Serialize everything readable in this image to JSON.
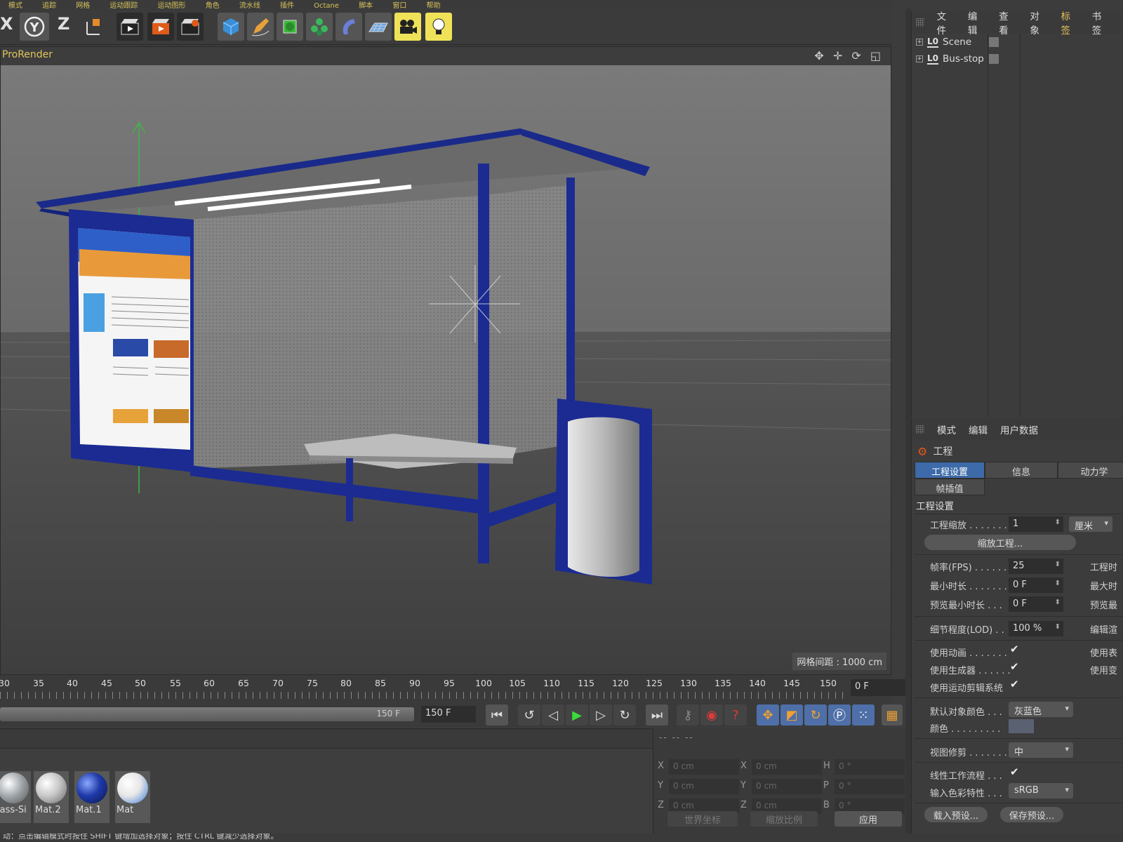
{
  "app": {
    "top_menu": [
      "模式",
      "追踪",
      "网格",
      "运动跟踪",
      "运动图形",
      "角色",
      "流水线",
      "插件",
      "Octane",
      "脚本",
      "窗口",
      "帮助"
    ]
  },
  "toolbar": {
    "x_label": "X",
    "y_label": "Y",
    "z_label": "Z"
  },
  "viewport": {
    "renderer_label": "ProRender",
    "nav_icons": "✥ ✛ ⟳ ◱",
    "grid_spacing": "网格间距 : 1000 cm"
  },
  "timeline": {
    "ticks": [
      "30",
      "35",
      "40",
      "45",
      "50",
      "55",
      "60",
      "65",
      "70",
      "75",
      "80",
      "85",
      "90",
      "95",
      "100",
      "105",
      "110",
      "115",
      "120",
      "125",
      "130",
      "135",
      "140",
      "145",
      "150"
    ],
    "current_frame": "0 F",
    "slider_end": "150 F",
    "end_frame_field": "150 F"
  },
  "materials": [
    {
      "name": "lass-Si",
      "color": "#9aa0a4"
    },
    {
      "name": "Mat.2",
      "color": "#c8c8c8"
    },
    {
      "name": "Mat.1",
      "color": "#1f3aa8"
    },
    {
      "name": "Mat",
      "color": "#e6e6e6"
    }
  ],
  "coords": {
    "header": "-- -- --",
    "rows": [
      {
        "a": "X",
        "av": "0 cm",
        "b": "X",
        "bv": "0 cm",
        "c": "H",
        "cv": "0 °"
      },
      {
        "a": "Y",
        "av": "0 cm",
        "b": "Y",
        "bv": "0 cm",
        "c": "P",
        "cv": "0 °"
      },
      {
        "a": "Z",
        "av": "0 cm",
        "b": "Z",
        "bv": "0 cm",
        "c": "B",
        "cv": "0 °"
      }
    ],
    "world_coords": "世界坐标",
    "scale": "缩放比例",
    "apply": "应用"
  },
  "object_manager": {
    "menu": [
      "文件",
      "编辑",
      "查看",
      "对象",
      "标签",
      "书签"
    ],
    "active_menu": "标签",
    "objects": [
      {
        "name": "Scene",
        "layer": "L0"
      },
      {
        "name": "Bus-stop",
        "layer": "L0"
      }
    ]
  },
  "attributes": {
    "menu": [
      "模式",
      "编辑",
      "用户数据"
    ],
    "title": "工程",
    "tabs": [
      "工程设置",
      "信息",
      "动力学",
      "帧插值"
    ],
    "section": "工程设置",
    "project_scale_label": "工程缩放 . . . . . . .",
    "project_scale_value": "1",
    "project_scale_unit": "厘米",
    "scale_project_btn": "缩放工程...",
    "fps_label": "帧率(FPS) . . . . . .",
    "fps_value": "25",
    "project_time_label": "工程时",
    "min_time_label": "最小时长 . . . . . . .",
    "min_time_value": "0 F",
    "max_time_label": "最大时",
    "preview_min_label": "预览最小时长 . . .",
    "preview_min_value": "0 F",
    "preview_max_label": "预览最",
    "lod_label": "细节程度(LOD) . .",
    "lod_value": "100 %",
    "render_lod_label": "编辑渲",
    "use_anim_label": "使用动画 . . . . . . .",
    "use_expr_label": "使用表",
    "use_gen_label": "使用生成器 . . . . . .",
    "use_deform_label": "使用变",
    "use_motion_label": "使用运动剪辑系统",
    "default_color_label": "默认对象颜色 . . .",
    "default_color_value": "灰蓝色",
    "color_label": "颜色 . . . . . . . . .",
    "view_clip_label": "视图修剪 . . . . . . .",
    "view_clip_value": "中",
    "linear_label": "线性工作流程 . . .",
    "input_color_label": "输入色彩特性 . . .",
    "input_color_value": "sRGB",
    "load_preset": "载入预设...",
    "save_preset": "保存预设..."
  },
  "status": {
    "text": "动：点击编辑模式时按住 SHIFT 键增加选择对象；按住 CTRL 键减少选择对象。"
  },
  "colors": {
    "accent_blue": "#3d6aa8",
    "highlight_yellow": "#efe259",
    "menu_active": "#e6c45a"
  }
}
